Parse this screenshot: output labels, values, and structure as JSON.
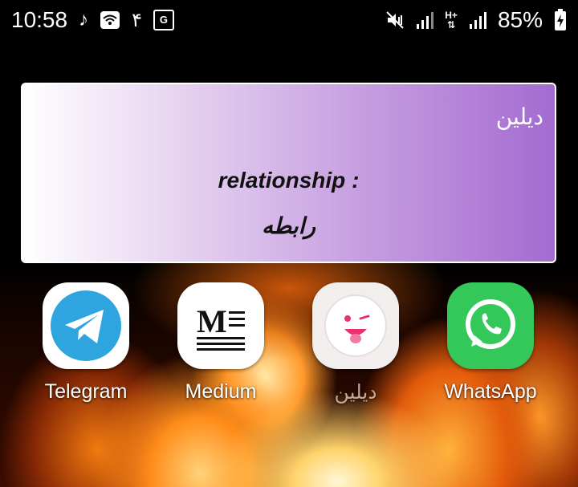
{
  "status_bar": {
    "time": "10:58",
    "music_icon": "♪",
    "persian_number": "۴",
    "translate_icon_text": "G",
    "network_label": "H+",
    "battery_percent": "85%"
  },
  "widget": {
    "title": "دیلین",
    "word": "relationship :",
    "translation": "رابطه"
  },
  "apps": [
    {
      "label": "Telegram",
      "icon": "telegram-icon",
      "color": "#2ea5df"
    },
    {
      "label": "Medium",
      "icon": "medium-icon",
      "color": "#111111"
    },
    {
      "label": "دیلین",
      "icon": "dilin-icon",
      "color": "#e8336d"
    },
    {
      "label": "WhatsApp",
      "icon": "whatsapp-icon",
      "color": "#34c759"
    }
  ]
}
